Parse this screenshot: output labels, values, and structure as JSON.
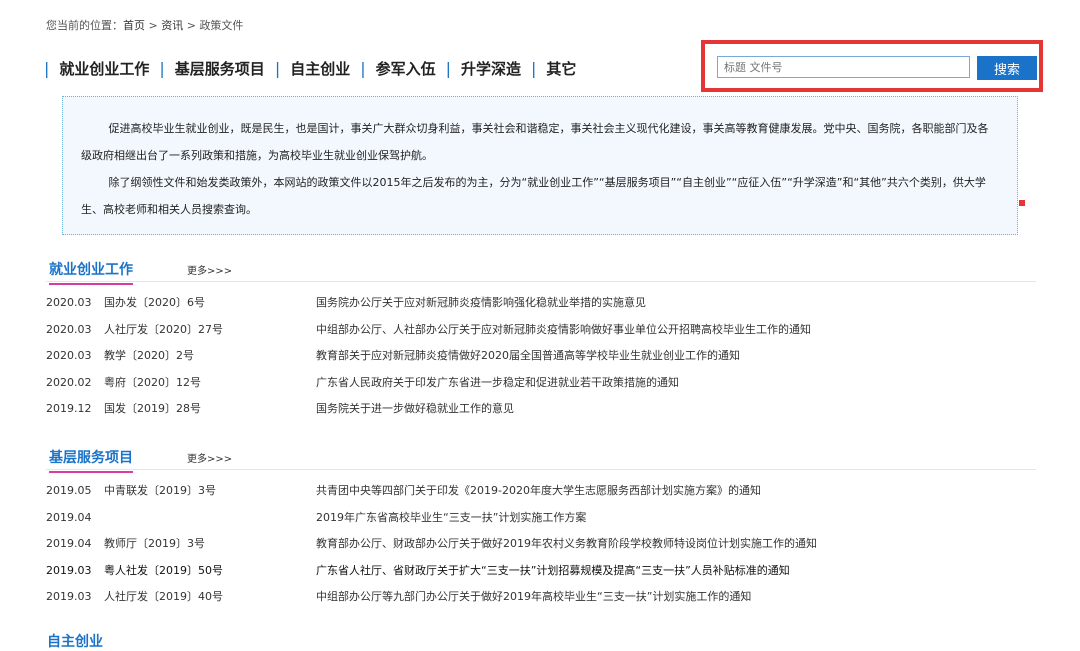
{
  "breadcrumb": {
    "prefix": "您当前的位置：",
    "home": "首页",
    "sep1": " > ",
    "news": "资讯",
    "sep2": " > ",
    "current": "政策文件"
  },
  "nav": {
    "items": [
      "就业创业工作",
      "基层服务项目",
      "自主创业",
      "参军入伍",
      "升学深造",
      "其它"
    ],
    "separator": "|"
  },
  "search": {
    "placeholder": "标题 文件号",
    "button": "搜索"
  },
  "intro": {
    "p1": "促进高校毕业生就业创业，既是民生，也是国计，事关广大群众切身利益，事关社会和谐稳定，事关社会主义现代化建设，事关高等教育健康发展。党中央、国务院，各职能部门及各级政府相继出台了一系列政策和措施，为高校毕业生就业创业保驾护航。",
    "p2": "除了纲领性文件和始发类政策外，本网站的政策文件以2015年之后发布的为主，分为“就业创业工作”“基层服务项目”“自主创业”“应征入伍”“升学深造”和“其他”共六个类别，供大学生、高校老师和相关人员搜索查询。"
  },
  "sections": [
    {
      "title": "就业创业工作",
      "more": "更多>>>",
      "rows": [
        {
          "date": "2020.03",
          "doc": "国办发〔2020〕6号",
          "title": "国务院办公厅关于应对新冠肺炎疫情影响强化稳就业举措的实施意见"
        },
        {
          "date": "2020.03",
          "doc": "人社厅发〔2020〕27号",
          "title": "中组部办公厅、人社部办公厅关于应对新冠肺炎疫情影响做好事业单位公开招聘高校毕业生工作的通知"
        },
        {
          "date": "2020.03",
          "doc": "教学〔2020〕2号",
          "title": "教育部关于应对新冠肺炎疫情做好2020届全国普通高等学校毕业生就业创业工作的通知"
        },
        {
          "date": "2020.02",
          "doc": "粤府〔2020〕12号",
          "title": "广东省人民政府关于印发广东省进一步稳定和促进就业若干政策措施的通知"
        },
        {
          "date": "2019.12",
          "doc": "国发〔2019〕28号",
          "title": "国务院关于进一步做好稳就业工作的意见"
        }
      ]
    },
    {
      "title": "基层服务项目",
      "more": "更多>>>",
      "rows": [
        {
          "date": "2019.05",
          "doc": "中青联发〔2019〕3号",
          "title": "共青团中央等四部门关于印发《2019-2020年度大学生志愿服务西部计划实施方案》的通知"
        },
        {
          "date": "2019.04",
          "doc": "",
          "title": "2019年广东省高校毕业生“三支一扶”计划实施工作方案"
        },
        {
          "date": "2019.04",
          "doc": "教师厅〔2019〕3号",
          "title": "教育部办公厅、财政部办公厅关于做好2019年农村义务教育阶段学校教师特设岗位计划实施工作的通知"
        },
        {
          "date": "2019.03",
          "doc": "粤人社发〔2019〕50号",
          "title": "广东省人社厅、省财政厅关于扩大“三支一扶”计划招募规模及提高“三支一扶”人员补贴标准的通知"
        },
        {
          "date": "2019.03",
          "doc": "人社厅发〔2019〕40号",
          "title": "中组部办公厅等九部门办公厅关于做好2019年高校毕业生“三支一扶”计划实施工作的通知"
        }
      ]
    }
  ],
  "next_section_title": "自主创业"
}
